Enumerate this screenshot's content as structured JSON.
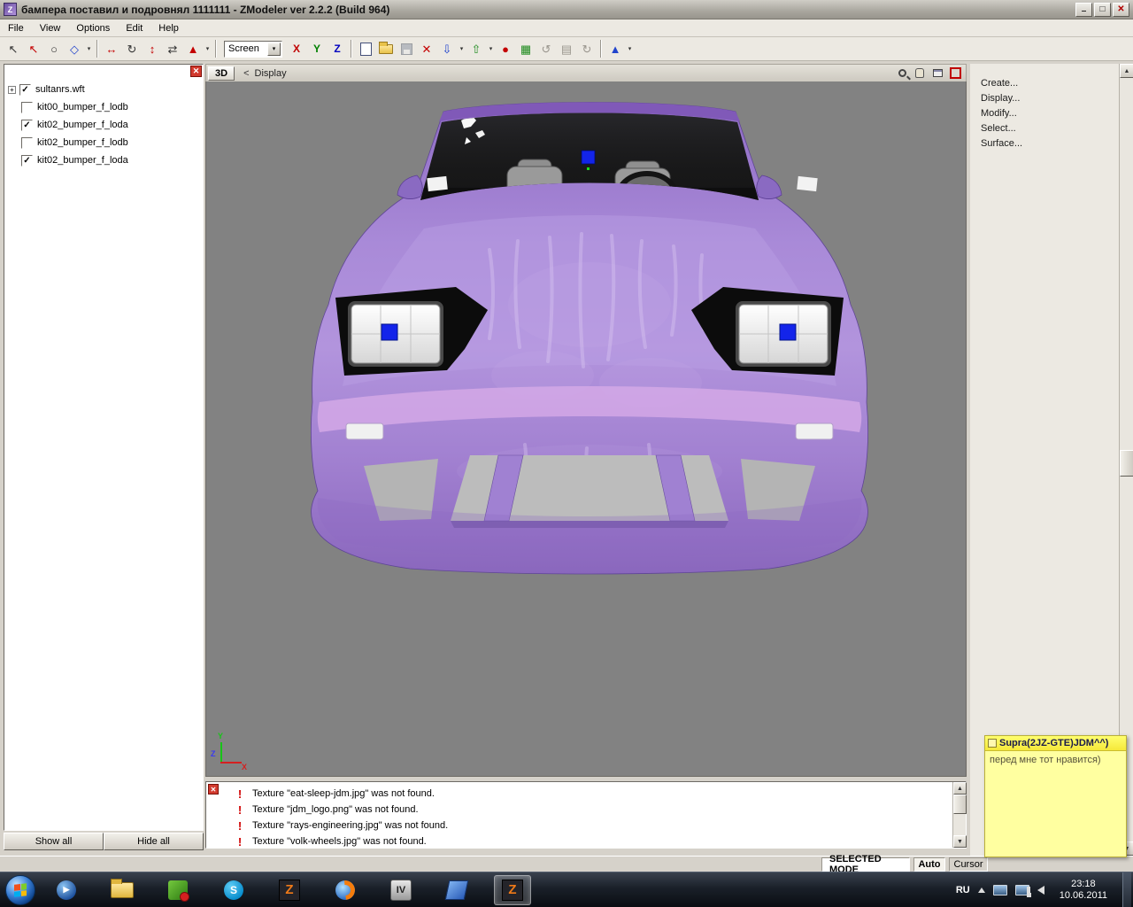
{
  "window": {
    "title": "бампера поставил и подровнял 1111111 - ZModeler ver 2.2.2 (Build 964)"
  },
  "menubar": {
    "items": [
      {
        "label": "File"
      },
      {
        "label": "View"
      },
      {
        "label": "Options"
      },
      {
        "label": "Edit"
      },
      {
        "label": "Help"
      }
    ]
  },
  "toolbar": {
    "screen_select": {
      "value": "Screen"
    },
    "axis_x": "X",
    "axis_y": "Y",
    "axis_z": "Z"
  },
  "scene_tree": {
    "items": [
      {
        "label": "sultanrs.wft",
        "checked": true
      },
      {
        "label": "kit00_bumper_f_lodb",
        "checked": false
      },
      {
        "label": "kit02_bumper_f_loda",
        "checked": true
      },
      {
        "label": "kit02_bumper_f_lodb",
        "checked": false
      },
      {
        "label": "kit02_bumper_f_loda",
        "checked": true
      }
    ],
    "show_all_label": "Show all",
    "hide_all_label": "Hide all"
  },
  "viewport": {
    "tab_label": "3D",
    "back_label": "<",
    "view_name": "Display",
    "axis": {
      "x": "X",
      "y": "Y",
      "z": "Z"
    }
  },
  "command_panel": {
    "items": [
      {
        "label": "Create..."
      },
      {
        "label": "Display..."
      },
      {
        "label": "Modify..."
      },
      {
        "label": "Select..."
      },
      {
        "label": "Surface..."
      }
    ]
  },
  "log_panel": {
    "entries": [
      {
        "text": "Texture \"eat-sleep-jdm.jpg\" was not found."
      },
      {
        "text": "Texture \"jdm_logo.png\" was not found."
      },
      {
        "text": "Texture \"rays-engineering.jpg\" was not found."
      },
      {
        "text": "Texture \"volk-wheels.jpg\" was not found."
      }
    ]
  },
  "sticky_note": {
    "title": "Supra(2JZ-GTE)JDM^^)",
    "body": "перед мне тот нравится)"
  },
  "statusbar": {
    "selected_mode": "SELECTED MODE",
    "auto": "Auto",
    "cursor": "Cursor"
  },
  "taskbar": {
    "tray": {
      "language": "RU",
      "time": "23:18",
      "date": "10.06.2011"
    }
  },
  "colors": {
    "viewport_bg": "#828282",
    "car_body": "#a283d6",
    "car_highlight": "#c9aee8",
    "selection_blue": "#1324ea",
    "note_yellow": "#ffffa0",
    "taskbar_bg": "#101418"
  }
}
